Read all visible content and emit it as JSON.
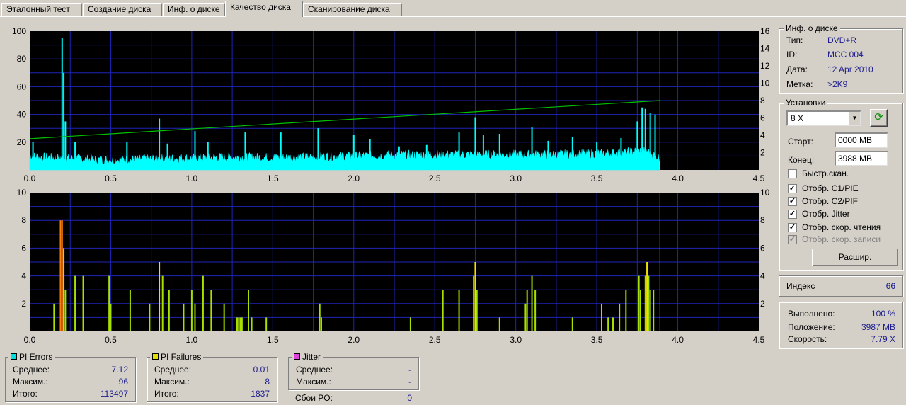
{
  "tabs": [
    {
      "label": "Эталонный тест",
      "active": false
    },
    {
      "label": "Создание диска",
      "active": false
    },
    {
      "label": "Инф. о диске",
      "active": false
    },
    {
      "label": "Качество диска",
      "active": true
    },
    {
      "label": "Сканирование диска",
      "active": false
    }
  ],
  "colors": {
    "plot_bg": "#000000",
    "grid": "#1f24b8",
    "pie": "#00ffff",
    "speed": "#00c000",
    "pif_green": "#a8e000",
    "pif_yellow": "#f0e000",
    "pif_orange": "#ff8000",
    "marker": "#ffffff",
    "value_text": "#1c1c8c"
  },
  "chart_data": [
    {
      "type": "area",
      "name": "PI Errors",
      "xlim": [
        0,
        4.5
      ],
      "ylim": [
        0,
        100
      ],
      "y2lim": [
        0,
        16
      ],
      "x_ticks": [
        "0.0",
        "0.5",
        "1.0",
        "1.5",
        "2.0",
        "2.5",
        "3.0",
        "3.5",
        "4.0",
        "4.5"
      ],
      "y_ticks": [
        "100",
        "80",
        "60",
        "40",
        "20"
      ],
      "y2_ticks": [
        "16",
        "14",
        "12",
        "10",
        "8",
        "6",
        "4",
        "2"
      ],
      "grid": true,
      "end_marker_x": 3.89,
      "baseline": [
        [
          0.0,
          10
        ],
        [
          0.1,
          9
        ],
        [
          0.3,
          8
        ],
        [
          0.5,
          7
        ],
        [
          0.8,
          8
        ],
        [
          1.2,
          9
        ],
        [
          1.6,
          9
        ],
        [
          2.0,
          10
        ],
        [
          2.4,
          11
        ],
        [
          2.8,
          11
        ],
        [
          3.2,
          11
        ],
        [
          3.6,
          12
        ],
        [
          3.8,
          14
        ],
        [
          3.88,
          9
        ]
      ],
      "spikes": [
        [
          0.02,
          20
        ],
        [
          0.2,
          95
        ],
        [
          0.21,
          70
        ],
        [
          0.22,
          35
        ],
        [
          0.28,
          20
        ],
        [
          0.6,
          20
        ],
        [
          0.8,
          37
        ],
        [
          0.85,
          19
        ],
        [
          1.02,
          28
        ],
        [
          1.1,
          20
        ],
        [
          1.33,
          27
        ],
        [
          1.55,
          27
        ],
        [
          1.78,
          30
        ],
        [
          2.0,
          25
        ],
        [
          2.1,
          22
        ],
        [
          2.28,
          17
        ],
        [
          2.45,
          18
        ],
        [
          2.65,
          27
        ],
        [
          2.75,
          38
        ],
        [
          2.8,
          25
        ],
        [
          2.9,
          26
        ],
        [
          3.1,
          31
        ],
        [
          3.2,
          21
        ],
        [
          3.35,
          24
        ],
        [
          3.5,
          20
        ],
        [
          3.65,
          23
        ],
        [
          3.75,
          35
        ],
        [
          3.78,
          45
        ],
        [
          3.8,
          44
        ],
        [
          3.83,
          41
        ],
        [
          3.86,
          40
        ]
      ],
      "speed_line": {
        "x": [
          0.0,
          3.89
        ],
        "y": [
          3.6,
          8.0
        ],
        "axis": "y2"
      }
    },
    {
      "type": "bar",
      "name": "PI Failures",
      "xlim": [
        0,
        4.5
      ],
      "ylim": [
        0,
        10
      ],
      "x_ticks": [
        "0.0",
        "0.5",
        "1.0",
        "1.5",
        "2.0",
        "2.5",
        "3.0",
        "3.5",
        "4.0",
        "4.5"
      ],
      "y_ticks": [
        "10",
        "8",
        "6",
        "4",
        "2"
      ],
      "y2_ticks": [
        "10",
        "8",
        "6",
        "4",
        "2"
      ],
      "grid": true,
      "end_marker_x": 3.89,
      "bars": [
        [
          0.15,
          2
        ],
        [
          0.19,
          8
        ],
        [
          0.2,
          8
        ],
        [
          0.21,
          6
        ],
        [
          0.22,
          3
        ],
        [
          0.28,
          4
        ],
        [
          0.33,
          4
        ],
        [
          0.49,
          4
        ],
        [
          0.5,
          2
        ],
        [
          0.62,
          3
        ],
        [
          0.74,
          2
        ],
        [
          0.8,
          5
        ],
        [
          0.82,
          4
        ],
        [
          0.86,
          3
        ],
        [
          0.95,
          2
        ],
        [
          1.0,
          3
        ],
        [
          1.02,
          2
        ],
        [
          1.07,
          4
        ],
        [
          1.12,
          3
        ],
        [
          1.2,
          2
        ],
        [
          1.28,
          1
        ],
        [
          1.29,
          1
        ],
        [
          1.3,
          1
        ],
        [
          1.31,
          1
        ],
        [
          1.35,
          3
        ],
        [
          1.37,
          1
        ],
        [
          1.46,
          1
        ],
        [
          1.79,
          2
        ],
        [
          1.8,
          1
        ],
        [
          2.35,
          1
        ],
        [
          2.55,
          3
        ],
        [
          2.65,
          3
        ],
        [
          2.74,
          4
        ],
        [
          2.75,
          5
        ],
        [
          2.76,
          3
        ],
        [
          2.9,
          1
        ],
        [
          3.06,
          2
        ],
        [
          3.07,
          3
        ],
        [
          3.1,
          4
        ],
        [
          3.12,
          3
        ],
        [
          3.35,
          1
        ],
        [
          3.53,
          2
        ],
        [
          3.57,
          1
        ],
        [
          3.6,
          1
        ],
        [
          3.64,
          2
        ],
        [
          3.68,
          3
        ],
        [
          3.76,
          4
        ],
        [
          3.77,
          3
        ],
        [
          3.8,
          4
        ],
        [
          3.81,
          5
        ],
        [
          3.82,
          4
        ],
        [
          3.83,
          3
        ],
        [
          3.85,
          3
        ]
      ]
    }
  ],
  "disc_info": {
    "title": "Инф. о диске",
    "rows": [
      {
        "k": "Тип:",
        "v": "DVD+R"
      },
      {
        "k": "ID:",
        "v": "MCC 004"
      },
      {
        "k": "Дата:",
        "v": "12 Apr 2010"
      },
      {
        "k": "Метка:",
        "v": ">2K9"
      }
    ]
  },
  "settings": {
    "title": "Установки",
    "speed": "8 X",
    "start_label": "Старт:",
    "start_value": "0000 MB",
    "end_label": "Конец:",
    "end_value": "3988 MB",
    "checkboxes": [
      {
        "label": "Быстр.скан.",
        "checked": false,
        "disabled": false
      },
      {
        "label": "Отобр. C1/PIE",
        "checked": true,
        "disabled": false
      },
      {
        "label": "Отобр. C2/PIF",
        "checked": true,
        "disabled": false
      },
      {
        "label": "Отобр. Jitter",
        "checked": true,
        "disabled": false
      },
      {
        "label": "Отобр. скор. чтения",
        "checked": true,
        "disabled": false
      },
      {
        "label": "Отобр. скор. записи",
        "checked": true,
        "disabled": true
      }
    ],
    "advanced_button": "Расшир."
  },
  "index": {
    "label": "Индекс",
    "value": "66"
  },
  "progress": {
    "rows": [
      {
        "k": "Выполнено:",
        "v": "100 %"
      },
      {
        "k": "Положение:",
        "v": "3987 MB"
      },
      {
        "k": "Скорость:",
        "v": "7.79 X"
      }
    ]
  },
  "stats": {
    "pi_errors": {
      "title": "PI Errors",
      "color": "#00e0e0",
      "rows": [
        {
          "k": "Среднее:",
          "v": "7.12"
        },
        {
          "k": "Максим.:",
          "v": "96"
        },
        {
          "k": "Итого:",
          "v": "113497"
        }
      ]
    },
    "pi_failures": {
      "title": "PI Failures",
      "color": "#e0e000",
      "rows": [
        {
          "k": "Среднее:",
          "v": "0.01"
        },
        {
          "k": "Максим.:",
          "v": "8"
        },
        {
          "k": "Итого:",
          "v": "1837"
        }
      ]
    },
    "jitter": {
      "title": "Jitter",
      "color": "#e040e0",
      "rows": [
        {
          "k": "Среднее:",
          "v": "-"
        },
        {
          "k": "Максим.:",
          "v": "-"
        }
      ]
    },
    "po_failures": {
      "k": "Сбои PO:",
      "v": "0"
    }
  }
}
